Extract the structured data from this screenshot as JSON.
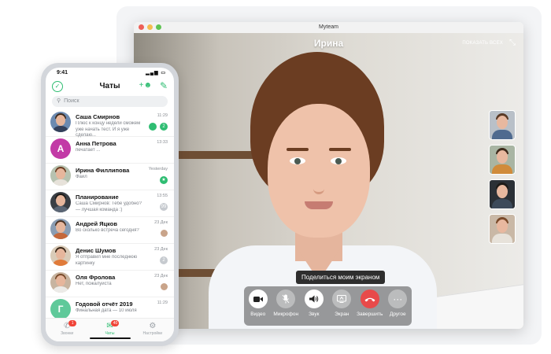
{
  "window": {
    "title": "Myteam",
    "caller_name": "Ирина",
    "show_all_label": "ПОКАЗАТЬ ВСЕХ",
    "tooltip": "Поделиться моим экраном",
    "controls": [
      {
        "label": "Видео",
        "icon": "video-camera-icon"
      },
      {
        "label": "Микрофон",
        "icon": "microphone-off-icon"
      },
      {
        "label": "Звук",
        "icon": "speaker-icon"
      },
      {
        "label": "Экран",
        "icon": "screen-share-icon"
      },
      {
        "label": "Завершить",
        "icon": "hangup-icon"
      },
      {
        "label": "Другое",
        "icon": "more-icon"
      }
    ]
  },
  "phone": {
    "time": "9:41",
    "title": "Чаты",
    "search_placeholder": "Поиск",
    "chats": [
      {
        "name": "Саша Смирнов",
        "preview": "Плюс к концу недели сможем уже начать тест. И я уже сделаю...",
        "time": "11:29",
        "badge": "2"
      },
      {
        "name": "Анна Петрова",
        "preview": "печатает ...",
        "time": "13:33",
        "letter": "А"
      },
      {
        "name": "Ирина Филлипова",
        "preview": "Файл",
        "time": "Yesterday"
      },
      {
        "name": "Планирование",
        "preview": "Саша Смирнов: Тебе удобно? — лучшая команда :)",
        "time": "13:55",
        "badge": "99"
      },
      {
        "name": "Андрей Яцков",
        "preview": "Во сколько встреча сегодня?",
        "time": "23 Дек"
      },
      {
        "name": "Денис Шумов",
        "preview": "Я отправил мне последнюю картинку",
        "time": "23 Дек",
        "badge": "2"
      },
      {
        "name": "Оля Фролова",
        "preview": "Нет, пожалуйста",
        "time": "23 Дек"
      },
      {
        "name": "Годовой отчёт 2019",
        "preview": "Финальная дата — 10 июля",
        "time": "11:29",
        "letter": "Г"
      }
    ],
    "tabs": [
      {
        "label": "Звонки",
        "badge": "1"
      },
      {
        "label": "Чаты",
        "badge": "40"
      },
      {
        "label": "Настройки"
      }
    ]
  },
  "colors": {
    "accent": "#2fbd72",
    "hangup": "#e84a4a",
    "badge_red": "#f04438"
  }
}
